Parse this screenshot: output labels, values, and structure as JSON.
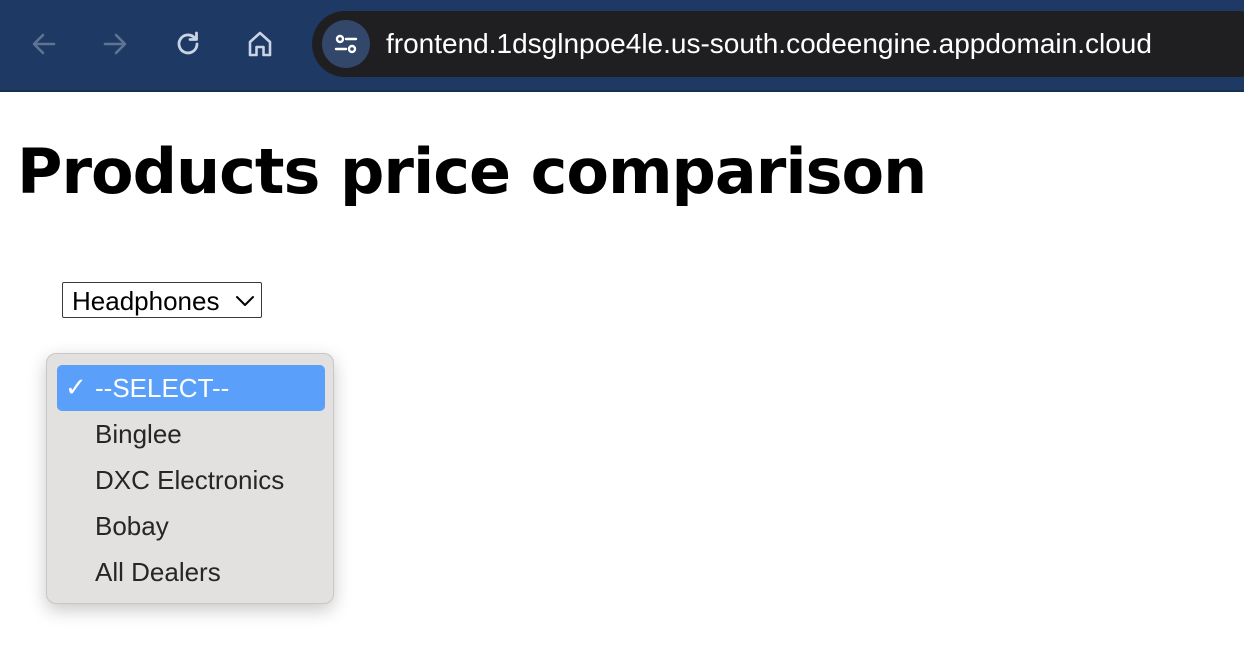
{
  "browser": {
    "url": "frontend.1dsglnpoe4le.us-south.codeengine.appdomain.cloud",
    "toolbar_color": "#1e3a64",
    "icons": [
      "back-arrow-icon",
      "forward-arrow-icon",
      "reload-icon",
      "home-icon",
      "site-info-icon"
    ]
  },
  "page": {
    "title": "Products price comparison"
  },
  "product_select": {
    "selected": "Headphones"
  },
  "dealer_dropdown": {
    "check_mark": "✓",
    "selected_color": "#5aa0fb",
    "options": [
      {
        "label": "--SELECT--",
        "selected": true
      },
      {
        "label": "Binglee",
        "selected": false
      },
      {
        "label": "DXC Electronics",
        "selected": false
      },
      {
        "label": "Bobay",
        "selected": false
      },
      {
        "label": "All Dealers",
        "selected": false
      }
    ]
  }
}
